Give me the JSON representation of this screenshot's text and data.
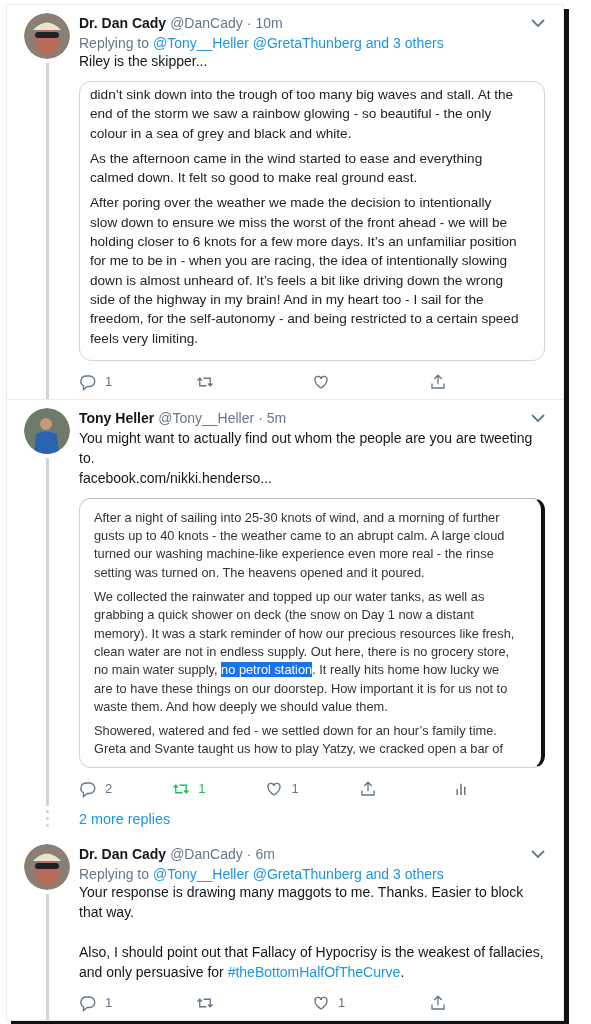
{
  "tweets": [
    {
      "name": "Dr. Dan Cady",
      "handle": "@DanCady",
      "separator": "·",
      "time": "10m",
      "replying_label": "Replying to",
      "replying_to": "@Tony__Heller @GretaThunberg and 3 others",
      "body": [
        [
          {
            "kind": "plain",
            "text": "Riley is the skipper..."
          }
        ]
      ],
      "embed": {
        "paragraphs": [
          [
            {
              "text": "didn’t sink down into the trough of too many big waves and stall. At the end of the storm we saw a rainbow glowing - so beautiful - the only colour in a sea of grey and black and white.",
              "highlighted": false
            }
          ],
          [
            {
              "text": "As the afternoon came in the wind started to ease and everything calmed down. It felt so good to make real ground east.",
              "highlighted": false
            }
          ],
          [
            {
              "text": "After poring over the weather we made the decision to intentionally slow down to ensure we miss the worst of the front ahead - we will be holding closer to 6 knots for a few more days. It’s an unfamiliar position for me to be in - when you are racing, the idea of intentionally slowing down is almost unheard of. It’s feels a bit like driving down the wrong side of the highway in my brain! And in my heart too - I sail for the freedom, for the self-autonomy - and being restricted to a certain speed feels very limiting.",
              "highlighted": false
            }
          ]
        ]
      },
      "actions": [
        {
          "kind": "reply",
          "count": "1",
          "selected": false
        },
        {
          "kind": "retweet",
          "selected": false
        },
        {
          "kind": "like",
          "selected": false
        },
        {
          "kind": "share",
          "selected": false
        }
      ]
    },
    {
      "name": "Tony Heller",
      "handle": "@Tony__Heller",
      "separator": "·",
      "time": "5m",
      "body": [
        [
          {
            "kind": "plain",
            "text": "You might want to actually find out whom the people are  you are tweeting to."
          }
        ],
        [
          {
            "kind": "link",
            "text": "facebook.com/nikki.henderso..."
          }
        ]
      ],
      "embed": {
        "paragraphs": [
          [
            {
              "text": "After a night of sailing into 25-30 knots of wind, and a morning of further gusts up to 40 knots - the weather came to an abrupt calm. A large cloud turned our washing machine-like experience even more real - the rinse setting was turned on. The heavens opened and it poured.",
              "highlighted": false
            }
          ],
          [
            {
              "text": "We collected the rainwater and topped up our water tanks, as well as grabbing a quick shower on deck (the snow on Day 1 now a distant memory). It was a stark reminder of how our precious resources like fresh, clean water are not in endless supply. Out here, there is no grocery store, no main water supply, ",
              "highlighted": false
            },
            {
              "text": "no petrol station",
              "highlighted": true
            },
            {
              "text": ". It really hits home how lucky we are to have these things on our doorstep. How important it is for us not to waste them. And how deeply we should value them.",
              "highlighted": false
            }
          ],
          [
            {
              "text": "Showered, watered and fed - we settled down for an hour’s family time. Greta and Svante taught us how to play Yatzy, we cracked open a bar of",
              "highlighted": false
            }
          ]
        ]
      },
      "actions": [
        {
          "kind": "reply",
          "count": "2",
          "selected": false
        },
        {
          "kind": "retweet",
          "count": "1",
          "selected": true
        },
        {
          "kind": "like",
          "count": "1",
          "selected": false
        },
        {
          "kind": "share",
          "selected": false
        },
        {
          "kind": "analytics",
          "selected": false
        }
      ],
      "more_replies": "2 more replies"
    },
    {
      "name": "Dr. Dan Cady",
      "handle": "@DanCady",
      "separator": "·",
      "time": "6m",
      "replying_label": "Replying to",
      "replying_to": "@Tony__Heller @GretaThunberg and 3 others",
      "body": [
        [
          {
            "kind": "plain",
            "text": "Your response is drawing many maggots to me. Thanks. Easier to block that way."
          }
        ],
        [
          {
            "kind": "plain",
            "text": "Also, I should point out that Fallacy of Hypocrisy is the weakest of fallacies, and only persuasive for "
          },
          {
            "kind": "hashtag",
            "text": "#theBottomHalfOfTheCurve"
          },
          {
            "kind": "plain",
            "text": "."
          }
        ]
      ],
      "actions": [
        {
          "kind": "reply",
          "count": "1",
          "selected": false
        },
        {
          "kind": "retweet",
          "selected": false
        },
        {
          "kind": "like",
          "count": "1",
          "selected": false
        },
        {
          "kind": "share",
          "selected": false
        }
      ]
    }
  ]
}
